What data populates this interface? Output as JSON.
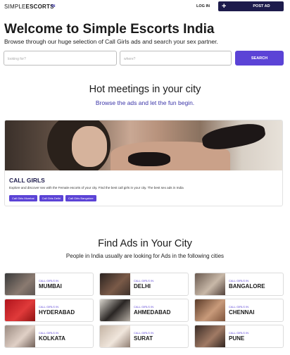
{
  "header": {
    "logo_part1": "SIMPLE",
    "logo_part2": "ESCORTS",
    "lang": "IN",
    "login": "LOG IN",
    "post_ad": "POST AD",
    "plus": "+"
  },
  "hero": {
    "title": "Welcome to Simple Escorts India",
    "subtitle": "Browse through our huge selection of Call Girls ads and search your sex partner."
  },
  "search": {
    "looking_placeholder": "looking for?",
    "where_placeholder": "where?",
    "button": "SEARCH"
  },
  "meetings": {
    "title": "Hot meetings in your city",
    "subtitle": "Browse the ads and let the fun begin."
  },
  "category_card": {
    "title": "CALL GIRLS",
    "description": "Explore and discover sex with the Female escorts of your city. Find the best call girls in your city. The best sex ads in India",
    "chips": [
      "Call Girls Mumbai",
      "Call Girls Delhi",
      "Call Girls Bangalore"
    ]
  },
  "find_ads": {
    "title": "Find Ads in Your City",
    "subtitle": "People in India usually are looking for Ads in the following cities"
  },
  "cities": [
    {
      "label": "CALL GIRLS IN",
      "name": "MUMBAI"
    },
    {
      "label": "CALL GIRLS IN",
      "name": "DELHI"
    },
    {
      "label": "CALL GIRLS IN",
      "name": "BANGALORE"
    },
    {
      "label": "CALL GIRLS IN",
      "name": "HYDERABAD"
    },
    {
      "label": "CALL GIRLS IN",
      "name": "AHMEDABAD"
    },
    {
      "label": "CALL GIRLS IN",
      "name": "CHENNAI"
    },
    {
      "label": "CALL GIRLS IN",
      "name": "KOLKATA"
    },
    {
      "label": "CALL GIRLS IN",
      "name": "SURAT"
    },
    {
      "label": "CALL GIRLS IN",
      "name": "PUNE"
    }
  ],
  "colors": {
    "accent": "#5b43d6",
    "navy": "#1d1b4c"
  }
}
